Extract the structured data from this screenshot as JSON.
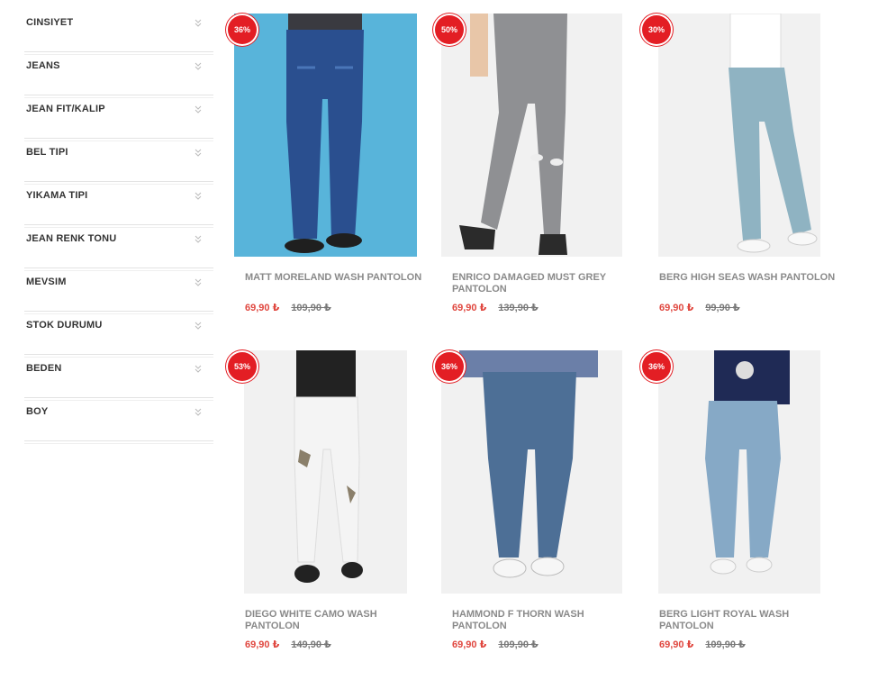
{
  "filters": [
    {
      "label": "CINSIYET"
    },
    {
      "label": "JEANS"
    },
    {
      "label": "JEAN FIT/KALIP"
    },
    {
      "label": "BEL TIPI"
    },
    {
      "label": "YIKAMA TIPI"
    },
    {
      "label": "JEAN RENK TONU"
    },
    {
      "label": "MEVSIM"
    },
    {
      "label": "STOK DURUMU"
    },
    {
      "label": "BEDEN"
    },
    {
      "label": "BOY"
    }
  ],
  "filter_icon": "double-chevron-down-icon",
  "products": [
    {
      "badge": "36%",
      "title": "MATT MORELAND WASH PANTOLON",
      "price": "69,90 ₺",
      "old_price": "109,90 ₺",
      "jeans_color": "#2a4f8f"
    },
    {
      "badge": "50%",
      "title": "ENRICO DAMAGED MUST GREY PANTOLON",
      "price": "69,90 ₺",
      "old_price": "139,90 ₺",
      "jeans_color": "#8f9093"
    },
    {
      "badge": "30%",
      "title": "BERG HIGH SEAS WASH PANTOLON",
      "price": "69,90 ₺",
      "old_price": "99,90 ₺",
      "jeans_color": "#8fb3c2"
    },
    {
      "badge": "53%",
      "title": "DIEGO WHITE CAMO WASH PANTOLON",
      "price": "69,90 ₺",
      "old_price": "149,90 ₺",
      "jeans_color": "#f4f4f4"
    },
    {
      "badge": "36%",
      "title": "HAMMOND F THORN WASH PANTOLON",
      "price": "69,90 ₺",
      "old_price": "109,90 ₺",
      "jeans_color": "#4d6f96"
    },
    {
      "badge": "36%",
      "title": "BERG LIGHT ROYAL WASH PANTOLON",
      "price": "69,90 ₺",
      "old_price": "109,90 ₺",
      "jeans_color": "#86a9c6"
    }
  ],
  "colors": {
    "badge": "#e31e24",
    "price": "#e0473f"
  }
}
